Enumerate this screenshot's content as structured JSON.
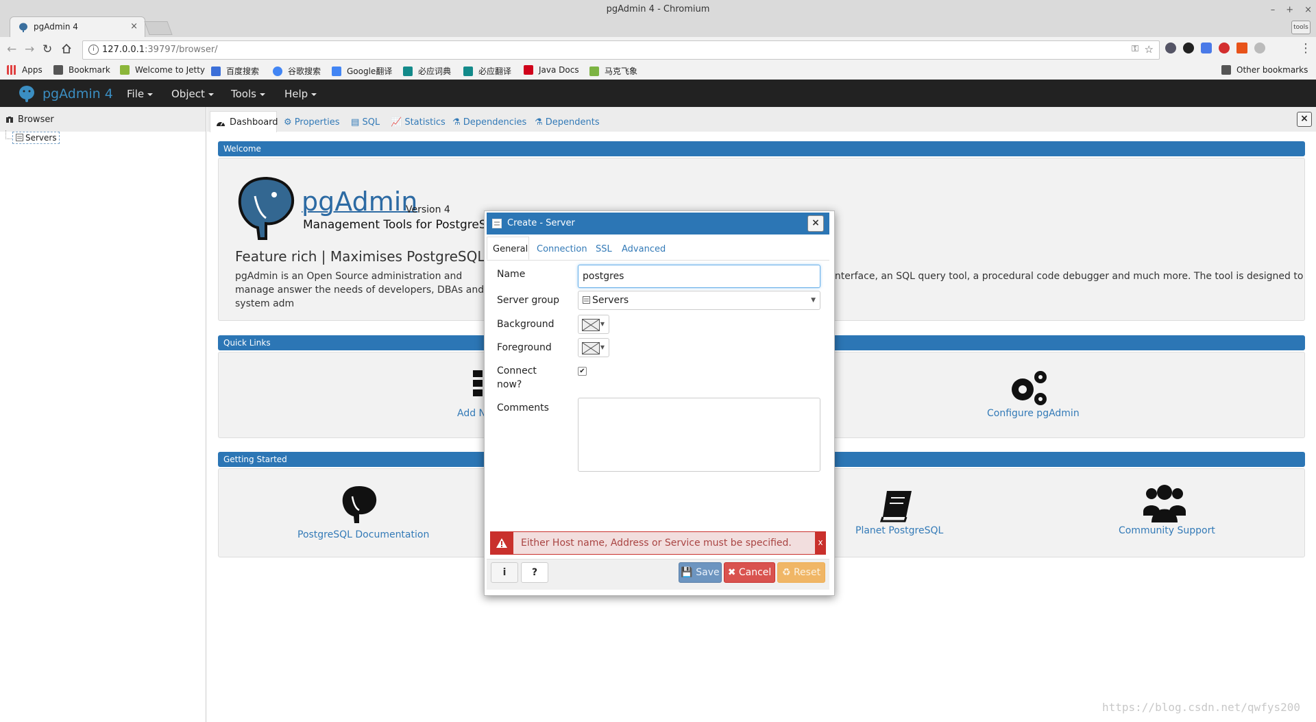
{
  "window": {
    "title": "pgAdmin 4 - Chromium",
    "controls": [
      "–",
      "+",
      "×"
    ]
  },
  "tabs": [
    {
      "title": "pgAdmin 4",
      "close": "×"
    }
  ],
  "extension_badge": "tools",
  "address_bar": {
    "host": "127.0.0.1",
    "rest": ":39797/browser/"
  },
  "bookmarks": [
    {
      "label": "Apps",
      "color": "#e04040"
    },
    {
      "label": "Bookmark",
      "color": "#555555"
    },
    {
      "label": "Welcome to Jetty",
      "color": "#8bb63a"
    },
    {
      "label": "百度搜索",
      "color": "#3b6fd8"
    },
    {
      "label": "谷歌搜索",
      "color": "#4285f4"
    },
    {
      "label": "Google翻译",
      "color": "#4285f4"
    },
    {
      "label": "必应词典",
      "color": "#138a8a"
    },
    {
      "label": "必应翻译",
      "color": "#138a8a"
    },
    {
      "label": "Java Docs",
      "color": "#d0021b"
    },
    {
      "label": "马克飞象",
      "color": "#7cb342"
    }
  ],
  "other_bookmarks": "Other bookmarks",
  "app": {
    "brand": "pgAdmin 4",
    "menus": [
      "File",
      "Object",
      "Tools",
      "Help"
    ]
  },
  "browser_panel": {
    "title": "Browser",
    "tree": [
      {
        "label": "Servers"
      }
    ]
  },
  "dashboard": {
    "tabs": [
      "Dashboard",
      "Properties",
      "SQL",
      "Statistics",
      "Dependencies",
      "Dependents"
    ],
    "welcome": {
      "header": "Welcome",
      "logo_word": "pgAdmin",
      "version": "Version 4",
      "tagline": "Management Tools for PostgreS",
      "feature_line": "Feature rich | Maximises PostgreSQL | Ope",
      "para_left": "pgAdmin is an Open Source administration and manage answer the needs of developers, DBAs and system adm",
      "para_right": "interface, an SQL query tool, a procedural code debugger and much more. The tool is designed to"
    },
    "quick_links": {
      "header": "Quick Links",
      "add_server_partial": "Add N",
      "configure": "Configure pgAdmin"
    },
    "getting_started": {
      "header": "Getting Started",
      "items": [
        "PostgreSQL Documentation",
        "Planet PostgreSQL",
        "Community Support"
      ]
    }
  },
  "dialog": {
    "title": "Create - Server",
    "close": "×",
    "tabs": [
      "General",
      "Connection",
      "SSL",
      "Advanced"
    ],
    "fields": {
      "name_label": "Name",
      "name_value": "postgres",
      "group_label": "Server group",
      "group_value": "Servers",
      "background_label": "Background",
      "foreground_label": "Foreground",
      "connect_label_1": "Connect",
      "connect_label_2": "now?",
      "connect_checked": true,
      "comments_label": "Comments",
      "comments_value": ""
    },
    "error": {
      "message": "Either Host name, Address or Service must be specified.",
      "close": "x"
    },
    "buttons": {
      "info": "i",
      "help": "?",
      "save": "Save",
      "cancel": "Cancel",
      "reset": "Reset"
    }
  },
  "watermark": "https://blog.csdn.net/qwfys200"
}
